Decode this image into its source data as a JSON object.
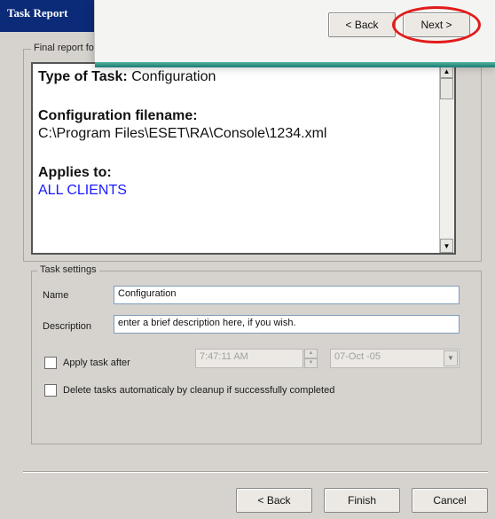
{
  "window": {
    "title": "Task Report"
  },
  "callout": {
    "back_label": "< Back",
    "next_label": "Next >"
  },
  "report_group": {
    "legend": "Final report for the new task"
  },
  "report": {
    "type_heading": "Type of Task:",
    "type_value": "Configuration",
    "config_heading": "Configuration filename:",
    "config_value": "C:\\Program Files\\ESET\\RA\\Console\\1234.xml",
    "applies_heading": "Applies to:",
    "applies_value": "ALL CLIENTS",
    "applies_color": "#1a1aff"
  },
  "settings": {
    "legend": "Task settings",
    "name_label": "Name",
    "name_value": "Configuration",
    "description_label": "Description",
    "description_value": "enter a brief description here, if you wish.",
    "apply_after_label": "Apply task after",
    "apply_after_checked": false,
    "time_value": "7:47:11 AM",
    "date_value": "07-Oct -05",
    "delete_label": "Delete tasks automaticaly by cleanup if successfully completed",
    "delete_checked": false
  },
  "footer": {
    "back_label": "< Back",
    "finish_label": "Finish",
    "cancel_label": "Cancel"
  },
  "colors": {
    "title_bar": "#0b2a78",
    "highlight_ring": "#e21b1b",
    "callout_band": "#1e7a72"
  }
}
